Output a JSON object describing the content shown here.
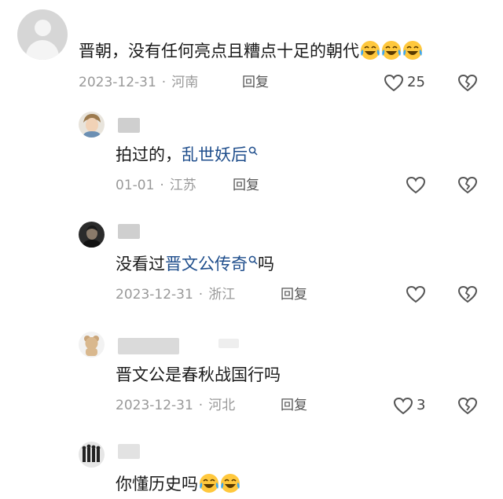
{
  "comments": [
    {
      "text": "晋朝，没有任何亮点且糟点十足的朝代",
      "emoji": [
        "laughing-crying-emoji",
        "laughing-crying-emoji",
        "laughing-crying-emoji"
      ],
      "date": "2023-12-31",
      "location": "河南",
      "reply_label": "回复",
      "likes": "25"
    },
    {
      "text_prefix": "拍过的，",
      "link": "乱世妖后",
      "date": "01-01",
      "location": "江苏",
      "reply_label": "回复"
    },
    {
      "text_prefix": "没看过",
      "link": "晋文公传奇",
      "text_suffix": "吗",
      "date": "2023-12-31",
      "location": "浙江",
      "reply_label": "回复"
    },
    {
      "text": "晋文公是春秋战国行吗",
      "date": "2023-12-31",
      "location": "河北",
      "reply_label": "回复",
      "likes": "3"
    },
    {
      "text": "你懂历史吗",
      "emoji": [
        "laughing-crying-emoji",
        "laughing-crying-emoji"
      ]
    }
  ],
  "icons": {
    "like": "heart-outline-icon",
    "dislike": "broken-heart-icon",
    "search": "search-icon"
  },
  "colors": {
    "link": "#1f4e8c",
    "meta": "#999999",
    "reply": "#555555"
  }
}
